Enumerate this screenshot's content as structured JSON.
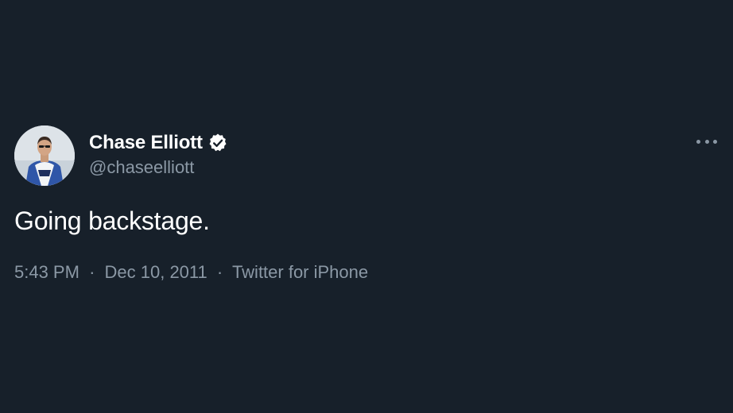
{
  "tweet": {
    "author": {
      "display_name": "Chase Elliott",
      "handle": "@chaseelliott",
      "verified": true,
      "avatar": "avatar-photo"
    },
    "text": "Going backstage.",
    "meta": {
      "time": "5:43 PM",
      "separator": "·",
      "date": "Dec 10, 2011",
      "source": "Twitter for iPhone"
    },
    "more_icon": "more-horizontal-icon",
    "verified_icon": "verified-badge-icon"
  },
  "colors": {
    "background": "#17202a",
    "primary_text": "#ffffff",
    "secondary_text": "#8b98a5"
  }
}
